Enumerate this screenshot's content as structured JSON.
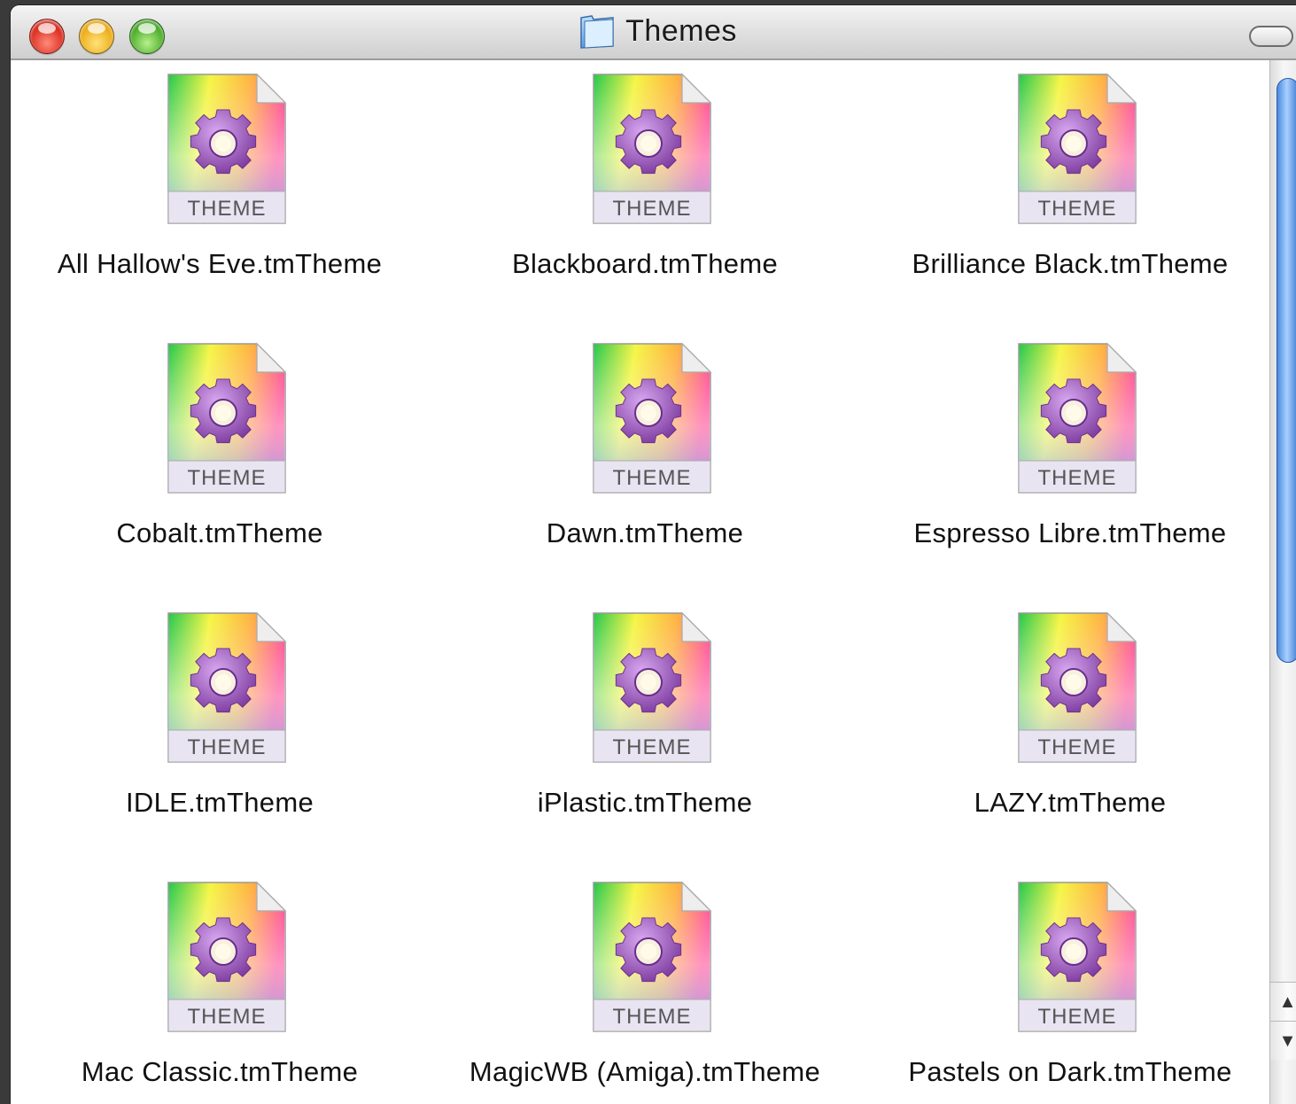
{
  "window": {
    "title": "Themes",
    "title_icon": "folder-icon"
  },
  "icon_badge_text": "THEME",
  "files": [
    {
      "name": "All Hallow's Eve.tmTheme"
    },
    {
      "name": "Blackboard.tmTheme"
    },
    {
      "name": "Brilliance Black.tmTheme"
    },
    {
      "name": "Cobalt.tmTheme"
    },
    {
      "name": "Dawn.tmTheme"
    },
    {
      "name": "Espresso Libre.tmTheme"
    },
    {
      "name": "IDLE.tmTheme"
    },
    {
      "name": "iPlastic.tmTheme"
    },
    {
      "name": "LAZY.tmTheme"
    },
    {
      "name": "Mac Classic.tmTheme"
    },
    {
      "name": "MagicWB (Amiga).tmTheme"
    },
    {
      "name": "Pastels on Dark.tmTheme"
    }
  ],
  "scrollbar": {
    "up_arrow": "▲",
    "down_arrow": "▼"
  },
  "colors": {
    "gear": "#9b59b6",
    "scroll_thumb": "#4b8be0"
  }
}
